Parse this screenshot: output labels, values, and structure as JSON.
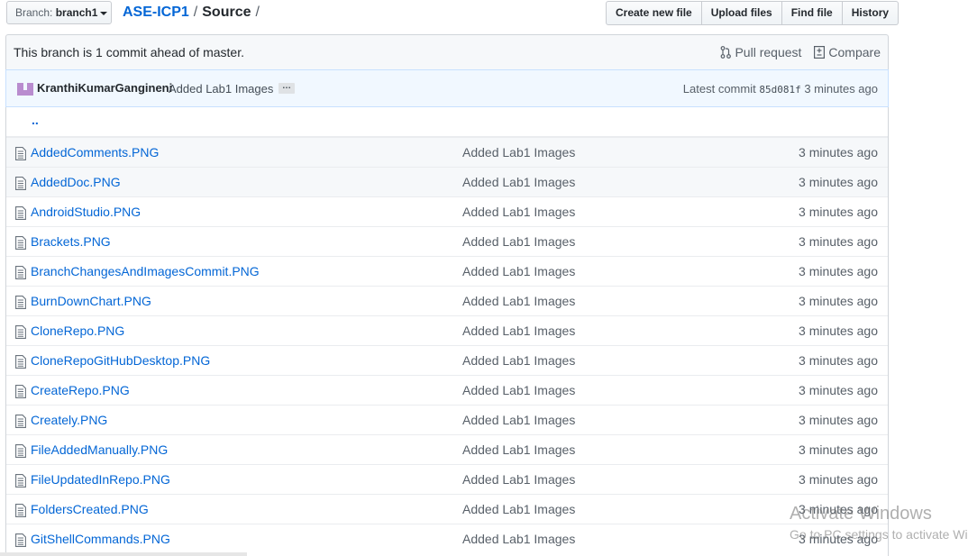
{
  "branch": {
    "prefix": "Branch:",
    "name": "branch1"
  },
  "breadcrumb": {
    "repo": "ASE-ICP1",
    "sep1": "/",
    "dir": "Source",
    "sep2": "/"
  },
  "actions": {
    "create": "Create new file",
    "upload": "Upload files",
    "find": "Find file",
    "history": "History"
  },
  "ahead_bar": {
    "message": "This branch is 1 commit ahead of master.",
    "pull_request": "Pull request",
    "compare": "Compare"
  },
  "commit": {
    "author": "KranthiKumarGangineni",
    "message": "Added Lab1 Images",
    "ellipsis": "…",
    "latest_prefix": "Latest commit",
    "sha": "85d081f",
    "age": "3 minutes ago"
  },
  "parent_dir": "..",
  "files": [
    {
      "name": "AddedComments.PNG",
      "message": "Added Lab1 Images",
      "age": "3 minutes ago"
    },
    {
      "name": "AddedDoc.PNG",
      "message": "Added Lab1 Images",
      "age": "3 minutes ago"
    },
    {
      "name": "AndroidStudio.PNG",
      "message": "Added Lab1 Images",
      "age": "3 minutes ago"
    },
    {
      "name": "Brackets.PNG",
      "message": "Added Lab1 Images",
      "age": "3 minutes ago"
    },
    {
      "name": "BranchChangesAndImagesCommit.PNG",
      "message": "Added Lab1 Images",
      "age": "3 minutes ago"
    },
    {
      "name": "BurnDownChart.PNG",
      "message": "Added Lab1 Images",
      "age": "3 minutes ago"
    },
    {
      "name": "CloneRepo.PNG",
      "message": "Added Lab1 Images",
      "age": "3 minutes ago"
    },
    {
      "name": "CloneRepoGitHubDesktop.PNG",
      "message": "Added Lab1 Images",
      "age": "3 minutes ago"
    },
    {
      "name": "CreateRepo.PNG",
      "message": "Added Lab1 Images",
      "age": "3 minutes ago"
    },
    {
      "name": "Creately.PNG",
      "message": "Added Lab1 Images",
      "age": "3 minutes ago"
    },
    {
      "name": "FileAddedManually.PNG",
      "message": "Added Lab1 Images",
      "age": "3 minutes ago"
    },
    {
      "name": "FileUpdatedInRepo.PNG",
      "message": "Added Lab1 Images",
      "age": "3 minutes ago"
    },
    {
      "name": "FoldersCreated.PNG",
      "message": "Added Lab1 Images",
      "age": "3 minutes ago"
    },
    {
      "name": "GitShellCommands.PNG",
      "message": "Added Lab1 Images",
      "age": "3 minutes ago"
    }
  ],
  "watermark": {
    "line1": "Activate Windows",
    "line2": "Go to PC settings to activate Windows."
  },
  "colors": {
    "link": "#0366d6",
    "commit_bar_bg": "#f1f8ff",
    "muted_text": "#586069"
  },
  "icons": {
    "file": "file-icon",
    "pull_request": "git-pull-request-icon",
    "compare": "diff-icon",
    "avatar": "identicon-avatar"
  }
}
